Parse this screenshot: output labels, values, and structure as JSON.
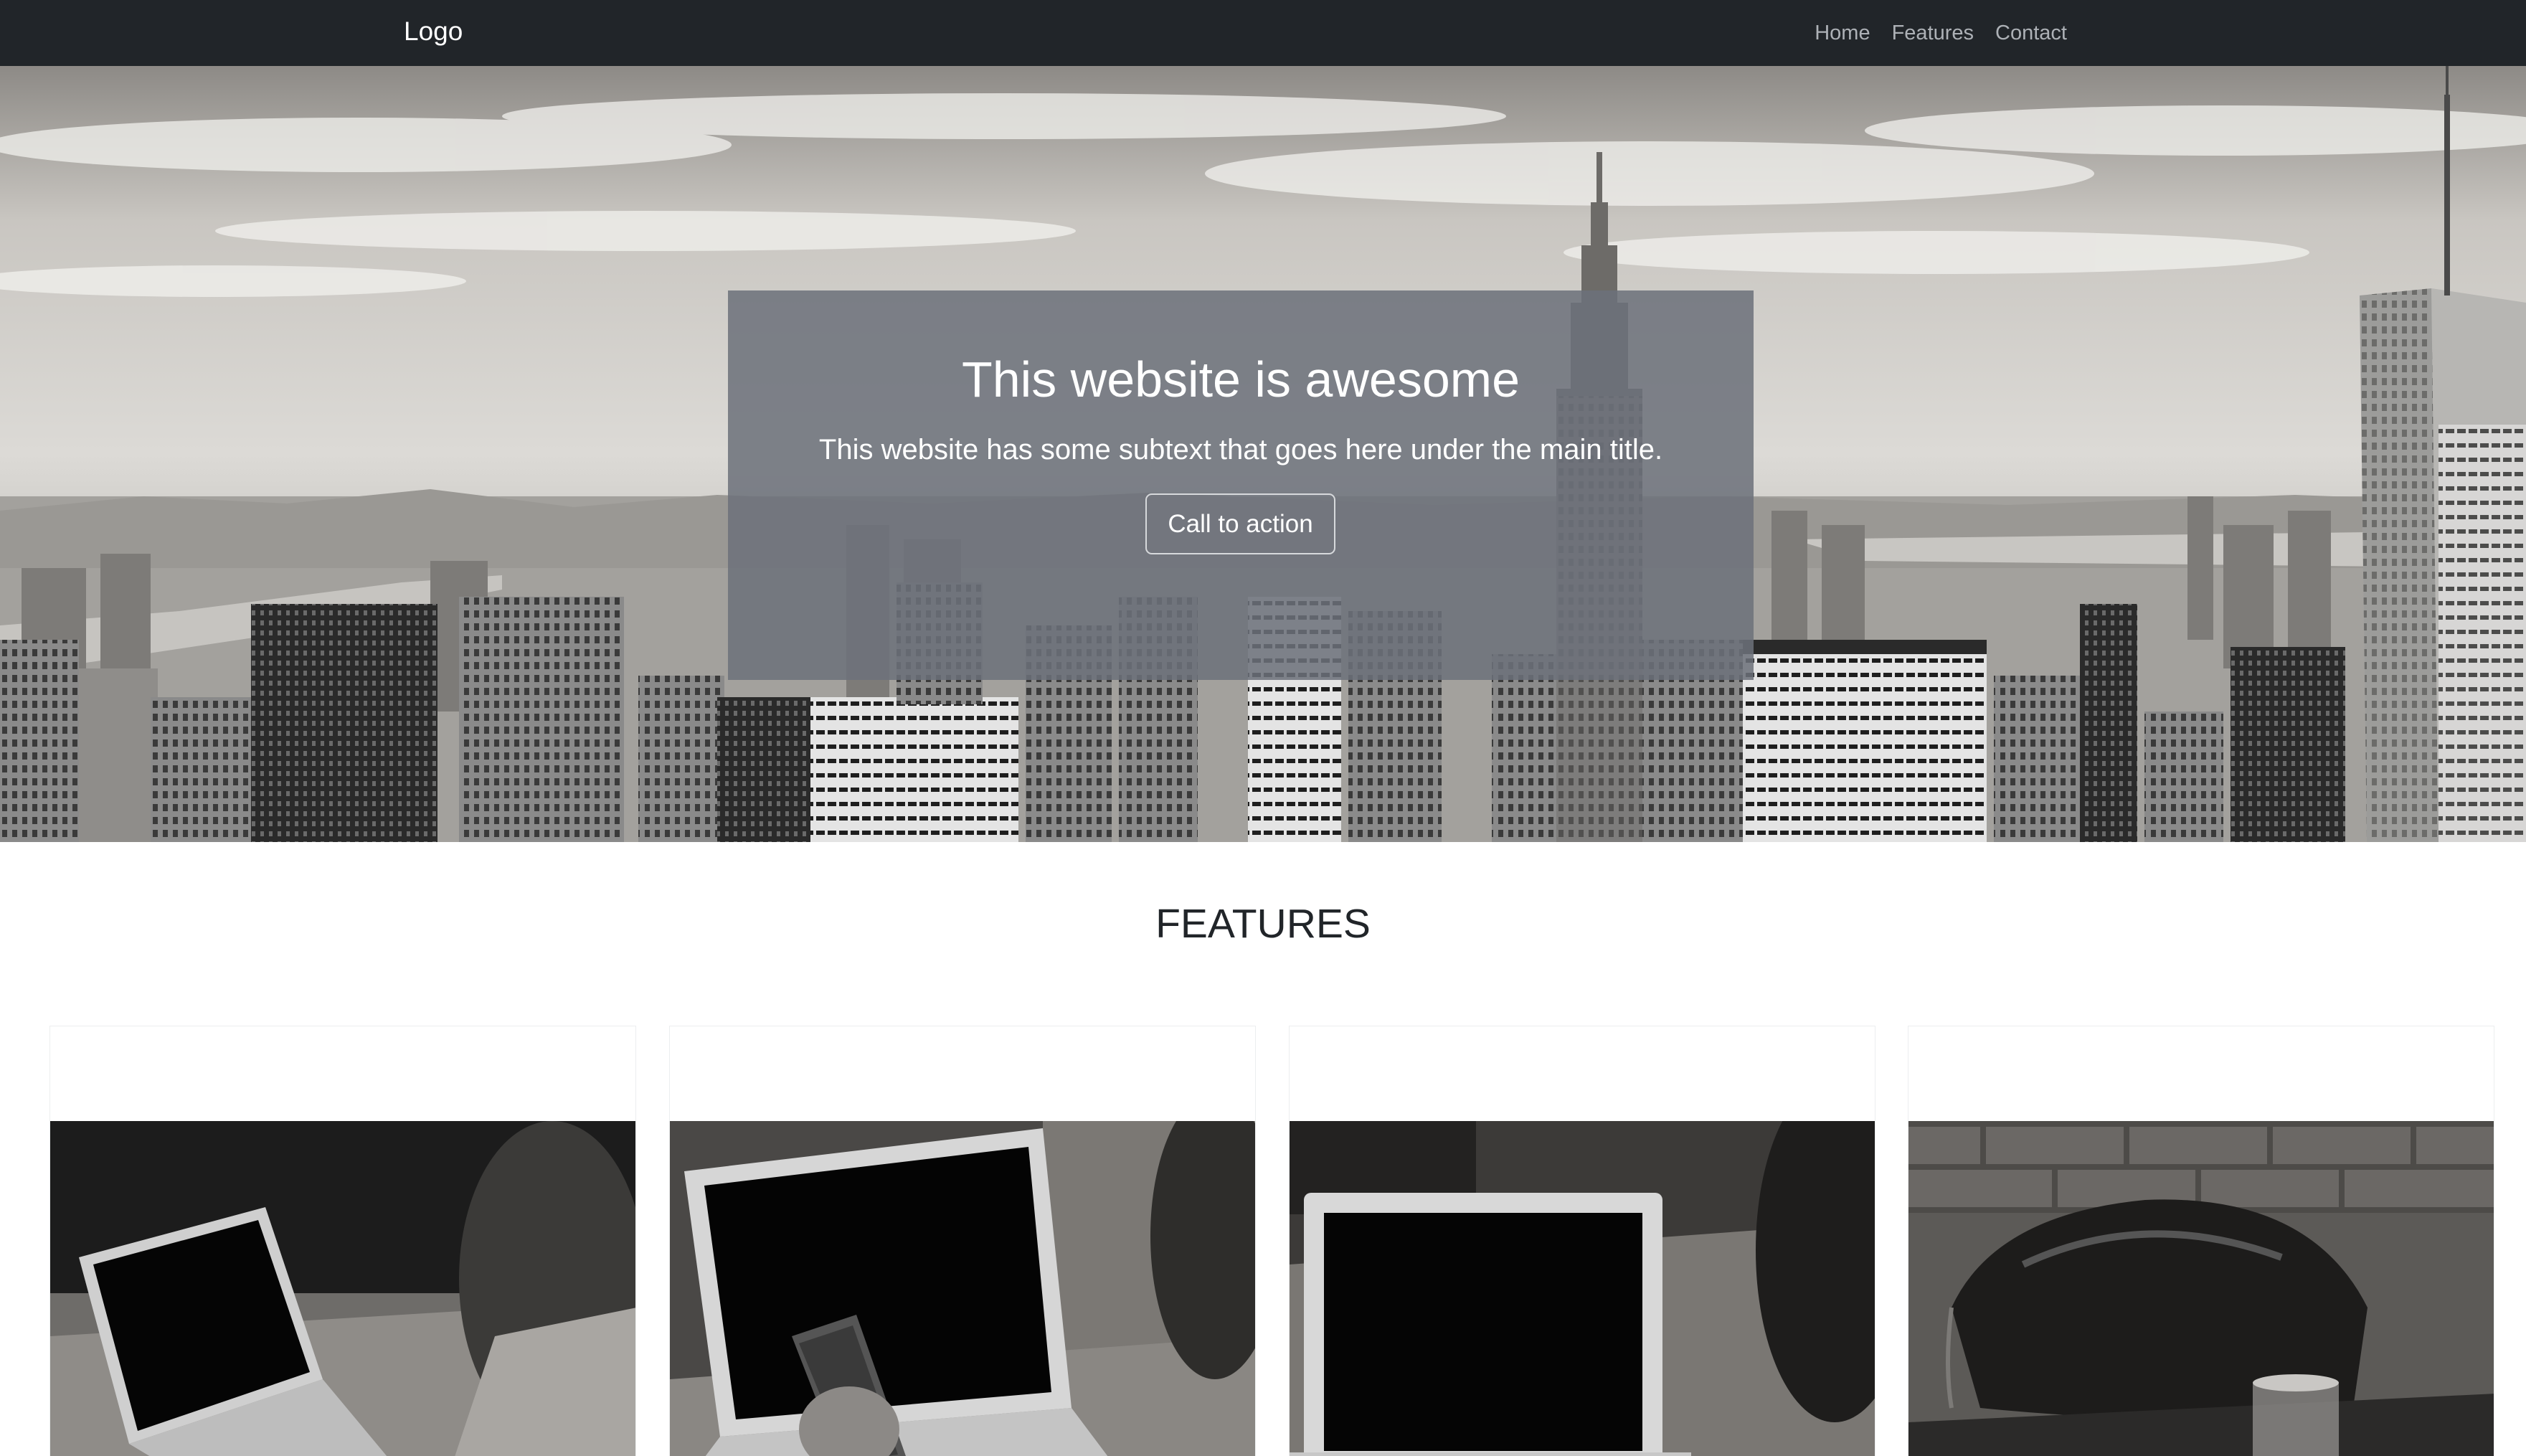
{
  "navbar": {
    "logo": "Logo",
    "links": [
      "Home",
      "Features",
      "Contact"
    ]
  },
  "hero": {
    "title": "This website is awesome",
    "subtitle": "This website has some subtext that goes here under the main title.",
    "cta_label": "Call to action"
  },
  "features": {
    "heading": "FEATURES",
    "cards": [
      {
        "image": "laptop-photo"
      },
      {
        "image": "laptop-phone-photo"
      },
      {
        "image": "laptop-table-photo"
      },
      {
        "image": "bag-glass-photo"
      }
    ]
  },
  "colors": {
    "navbar_bg": "#212529",
    "overlay": "#6c717a",
    "text_dark": "#212529"
  }
}
